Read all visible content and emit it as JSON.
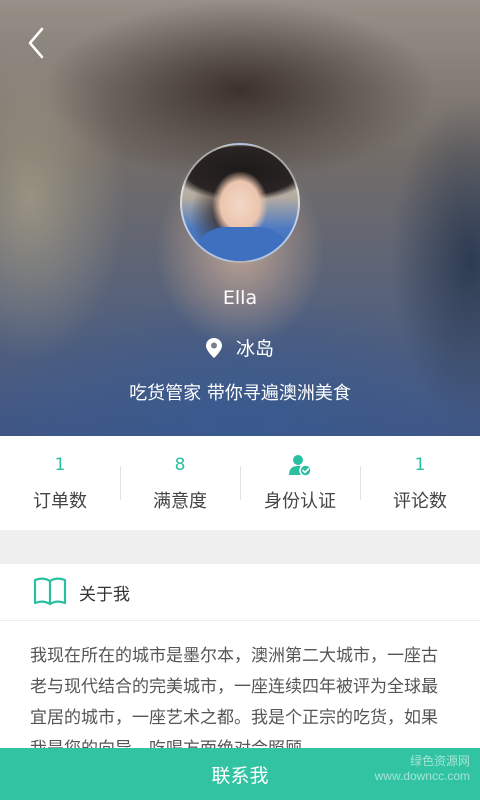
{
  "header": {
    "back_icon": "chevron-left-icon"
  },
  "profile": {
    "name": "Ella",
    "location": "冰岛",
    "tagline": "吃货管家 带你寻遍澳洲美食"
  },
  "stats": [
    {
      "value": "1",
      "label": "订单数"
    },
    {
      "value": "8",
      "label": "满意度"
    },
    {
      "value": "",
      "label": "身份认证",
      "icon": "verified-user-icon"
    },
    {
      "value": "1",
      "label": "评论数"
    }
  ],
  "about": {
    "title": "关于我",
    "text": "我现在所在的城市是墨尔本，澳洲第二大城市，一座古老与现代结合的完美城市，一座连续四年被评为全球最宜居的城市，一座艺术之都。我是个正宗的吃货，如果我是您的向导，吃喝方面绝对会照顾"
  },
  "contact_button": "联系我",
  "watermark": {
    "line1": "绿色资源网",
    "line2": "www.downcc.com"
  },
  "colors": {
    "accent": "#32c4a2",
    "stat_value": "#2bbfa2"
  }
}
